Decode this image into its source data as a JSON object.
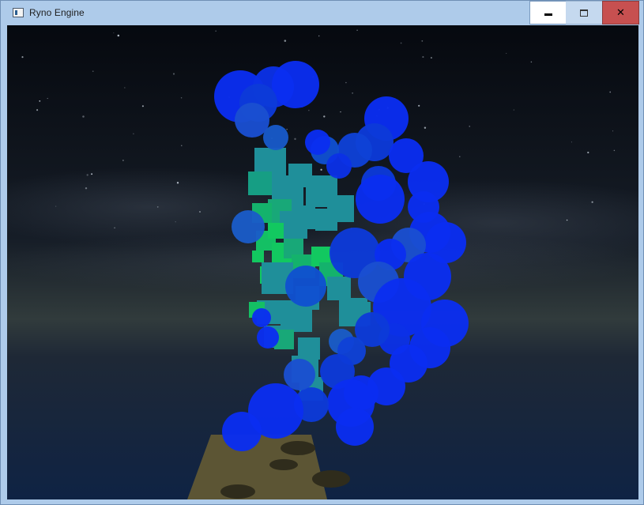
{
  "window": {
    "title": "Ryno Engine",
    "minimize_glyph": "minimize-icon",
    "maximize_glyph": "maximize-icon",
    "close_glyph": "✕"
  },
  "scene": {
    "sky_colors": [
      "#080b12",
      "#1b2330",
      "#3a4448"
    ],
    "sea_colors": [
      "#1a2436",
      "#14233e",
      "#0d1d3a"
    ],
    "terrain_color": "#5c5534",
    "sphere_color": "#0a2ef0",
    "cube_color_teal": "#1f8f9a",
    "cube_color_green": "#12c860"
  }
}
